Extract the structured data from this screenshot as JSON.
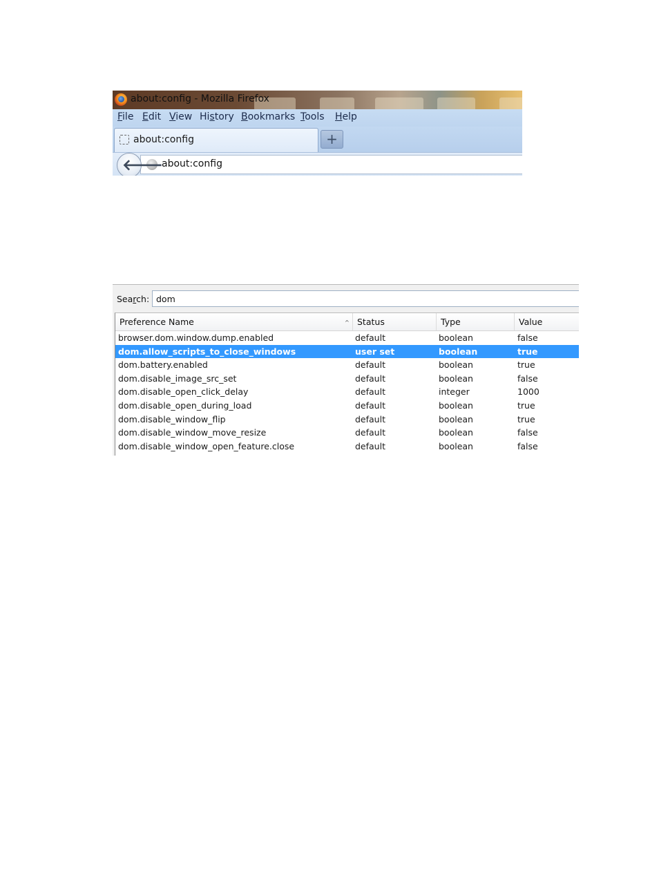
{
  "browser": {
    "window_title": "about:config - Mozilla Firefox",
    "menu": [
      {
        "hotkey": "F",
        "rest": "ile"
      },
      {
        "hotkey": "E",
        "rest": "dit"
      },
      {
        "hotkey": "V",
        "rest": "iew"
      },
      {
        "pre": "Hi",
        "hotkey": "s",
        "rest": "tory"
      },
      {
        "hotkey": "B",
        "rest": "ookmarks"
      },
      {
        "hotkey": "T",
        "rest": "ools"
      },
      {
        "hotkey": "H",
        "rest": "elp"
      }
    ],
    "tab_title": "about:config",
    "new_tab_symbol": "+",
    "url": "about:config",
    "back_symbol": "🡐",
    "icons": [
      "firefox-logo-icon",
      "tab-favicon-icon",
      "new-tab-icon",
      "back-arrow-icon",
      "globe-icon"
    ]
  },
  "config": {
    "search_label_pre": "Sea",
    "search_label_hotkey": "r",
    "search_label_post": "ch:",
    "search_value": "dom",
    "columns": {
      "name": "Preference Name",
      "status": "Status",
      "type": "Type",
      "value": "Value"
    },
    "sort_symbol": "^",
    "rows": [
      {
        "name": "browser.dom.window.dump.enabled",
        "status": "default",
        "type": "boolean",
        "value": "false",
        "selected": false
      },
      {
        "name": "dom.allow_scripts_to_close_windows",
        "status": "user set",
        "type": "boolean",
        "value": "true",
        "selected": true
      },
      {
        "name": "dom.battery.enabled",
        "status": "default",
        "type": "boolean",
        "value": "true",
        "selected": false
      },
      {
        "name": "dom.disable_image_src_set",
        "status": "default",
        "type": "boolean",
        "value": "false",
        "selected": false
      },
      {
        "name": "dom.disable_open_click_delay",
        "status": "default",
        "type": "integer",
        "value": "1000",
        "selected": false
      },
      {
        "name": "dom.disable_open_during_load",
        "status": "default",
        "type": "boolean",
        "value": "true",
        "selected": false
      },
      {
        "name": "dom.disable_window_flip",
        "status": "default",
        "type": "boolean",
        "value": "true",
        "selected": false
      },
      {
        "name": "dom.disable_window_move_resize",
        "status": "default",
        "type": "boolean",
        "value": "false",
        "selected": false
      },
      {
        "name": "dom.disable_window_open_feature.close",
        "status": "default",
        "type": "boolean",
        "value": "false",
        "selected": false
      }
    ],
    "selection_color": "#3399ff"
  }
}
